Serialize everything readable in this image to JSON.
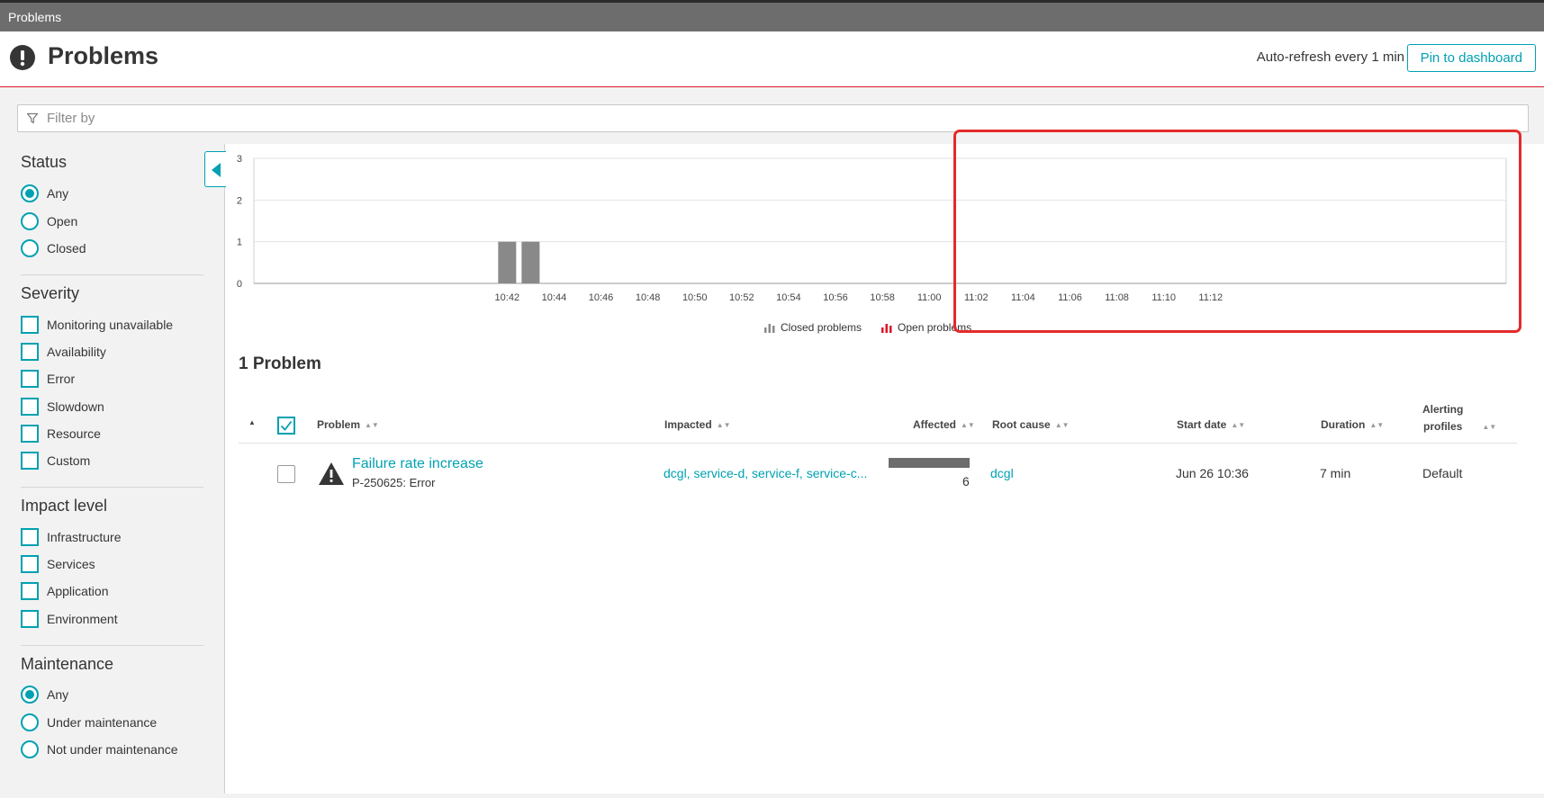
{
  "window_title": "Problems",
  "header": {
    "title": "Problems",
    "auto_refresh": "Auto-refresh every 1 min",
    "pin_button": "Pin to dashboard"
  },
  "filter": {
    "placeholder": "Filter by"
  },
  "sidebar": {
    "status": {
      "title": "Status",
      "options": [
        "Any",
        "Open",
        "Closed"
      ],
      "selected": "Any"
    },
    "severity": {
      "title": "Severity",
      "options": [
        "Monitoring unavailable",
        "Availability",
        "Error",
        "Slowdown",
        "Resource",
        "Custom"
      ]
    },
    "impact": {
      "title": "Impact level",
      "options": [
        "Infrastructure",
        "Services",
        "Application",
        "Environment"
      ]
    },
    "maintenance": {
      "title": "Maintenance",
      "options": [
        "Any",
        "Under maintenance",
        "Not under maintenance"
      ],
      "selected": "Any"
    }
  },
  "chart_data": {
    "type": "bar",
    "y_ticks": [
      "3",
      "2",
      "1",
      "0"
    ],
    "ylim": [
      0,
      3
    ],
    "x_ticks": [
      "10:42",
      "10:44",
      "10:46",
      "10:48",
      "10:50",
      "10:52",
      "10:54",
      "10:56",
      "10:58",
      "11:00",
      "11:02",
      "11:04",
      "11:06",
      "11:08",
      "11:10",
      "11:12"
    ],
    "x_range_minutes": [
      10.8,
      12.6
    ],
    "series": [
      {
        "name": "Closed problems",
        "color": "#898989",
        "x": [
          "10:42",
          "10:43"
        ],
        "values": [
          1,
          1
        ]
      },
      {
        "name": "Open problems",
        "color": "#dc172a",
        "x": [],
        "values": []
      }
    ],
    "grid": true,
    "legend_position": "bottom-center"
  },
  "results": {
    "count_label": "1 Problem",
    "columns": {
      "problem": "Problem",
      "impacted": "Impacted",
      "affected": "Affected",
      "root_cause": "Root cause",
      "start_date": "Start date",
      "duration": "Duration",
      "alerting_line1": "Alerting",
      "alerting_line2": "profiles"
    },
    "row": {
      "title": "Failure rate increase",
      "subtitle": "P-250625: Error",
      "impacted": "dcgl, service-d, service-f, service-c...",
      "affected_count": "6",
      "root_cause": "dcgl",
      "start_date": "Jun 26 10:36",
      "duration": "7 min",
      "alerting_profile": "Default"
    }
  },
  "colors": {
    "accent": "#00a1b2",
    "alert": "#dc172a",
    "highlight_box": "#e32b2b"
  }
}
